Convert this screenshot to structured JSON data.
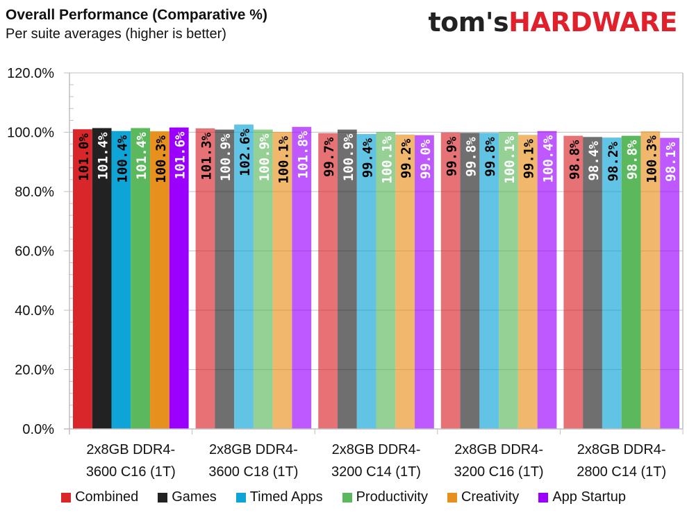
{
  "header": {
    "logo_left": "tom's",
    "logo_right": "HARDWARE"
  },
  "chart_data": {
    "type": "bar",
    "title": "Overall Performance (Comparative %)",
    "subtitle": "Per suite averages (higher is better)",
    "xlabel": "",
    "ylabel": "",
    "ylim": [
      0,
      120
    ],
    "yticks": [
      0,
      20,
      40,
      60,
      80,
      100,
      120
    ],
    "ytick_labels": [
      "0.0%",
      "20.0%",
      "40.0%",
      "60.0%",
      "80.0%",
      "100.0%",
      "120.0%"
    ],
    "grid": true,
    "legend_position": "bottom",
    "categories": [
      [
        "2x8GB DDR4-",
        "3600 C16 (1T)"
      ],
      [
        "2x8GB DDR4-",
        "3600 C18 (1T)"
      ],
      [
        "2x8GB DDR4-",
        "3200 C14 (1T)"
      ],
      [
        "2x8GB DDR4-",
        "3200 C16 (1T)"
      ],
      [
        "2x8GB DDR4-",
        "2800 C14 (1T)"
      ]
    ],
    "highlighted_category": 0,
    "series": [
      {
        "name": "Combined",
        "color": "#d9262b",
        "label_color": "#000000",
        "values": [
          101.0,
          101.3,
          99.7,
          99.9,
          98.8
        ],
        "highlight": [
          true,
          false,
          false,
          false,
          false
        ]
      },
      {
        "name": "Games",
        "color": "#222222",
        "label_color": "#ffffff",
        "values": [
          101.4,
          100.9,
          100.9,
          99.8,
          98.4
        ],
        "highlight": [
          true,
          false,
          false,
          false,
          false
        ]
      },
      {
        "name": "Timed Apps",
        "color": "#0ea5d6",
        "label_color": "#000000",
        "values": [
          100.4,
          102.6,
          99.4,
          99.8,
          98.2
        ],
        "highlight": [
          true,
          false,
          false,
          false,
          false
        ]
      },
      {
        "name": "Productivity",
        "color": "#5cb85c",
        "label_color": "#ffffff",
        "values": [
          101.4,
          100.9,
          100.1,
          100.1,
          98.8
        ],
        "highlight": [
          true,
          false,
          false,
          false,
          true
        ]
      },
      {
        "name": "Creativity",
        "color": "#e8901e",
        "label_color": "#000000",
        "values": [
          100.3,
          100.1,
          99.2,
          99.1,
          100.3
        ],
        "highlight": [
          true,
          false,
          false,
          false,
          false
        ]
      },
      {
        "name": "App Startup",
        "color": "#9b00ff",
        "label_color": "#ffffff",
        "values": [
          101.6,
          101.8,
          99.0,
          100.4,
          98.1
        ],
        "highlight": [
          true,
          false,
          false,
          false,
          false
        ]
      }
    ],
    "value_format": "{v}%"
  }
}
